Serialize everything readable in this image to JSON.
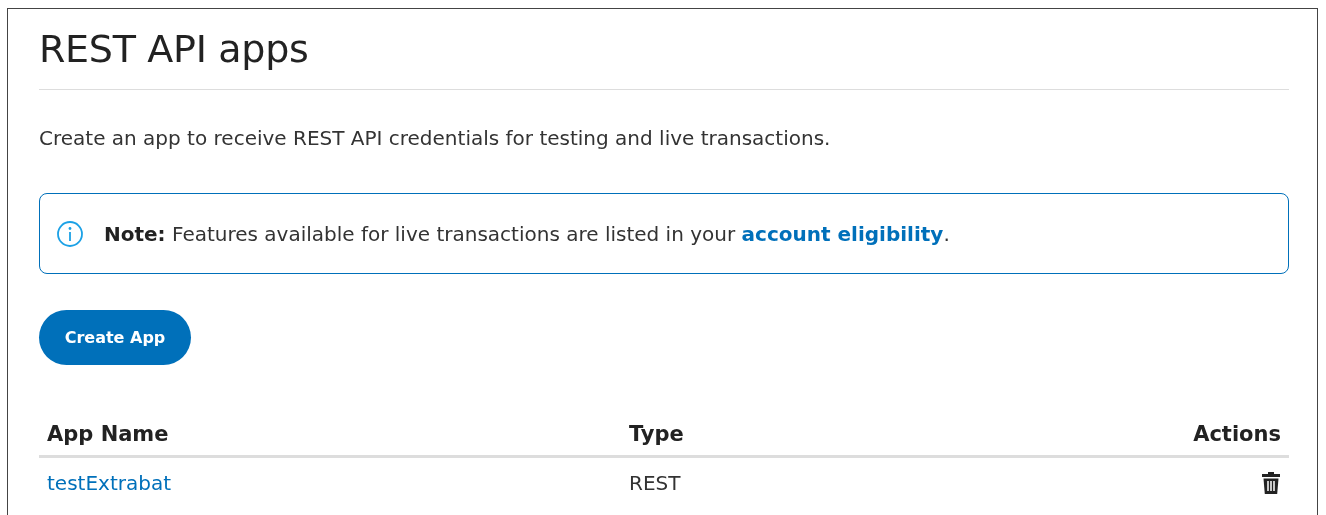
{
  "title": "REST API apps",
  "description": "Create an app to receive REST API credentials for testing and live transactions.",
  "note": {
    "text": "**Note:** Features available for live transactions are listed in your ",
    "link": "account eligibility",
    "after": "."
  },
  "create_button": "Create App",
  "table": {
    "columns": [
      "App Name",
      "Type",
      "Actions"
    ],
    "rows": [
      {
        "name": "testExtrabat",
        "type": "REST"
      }
    ]
  }
}
